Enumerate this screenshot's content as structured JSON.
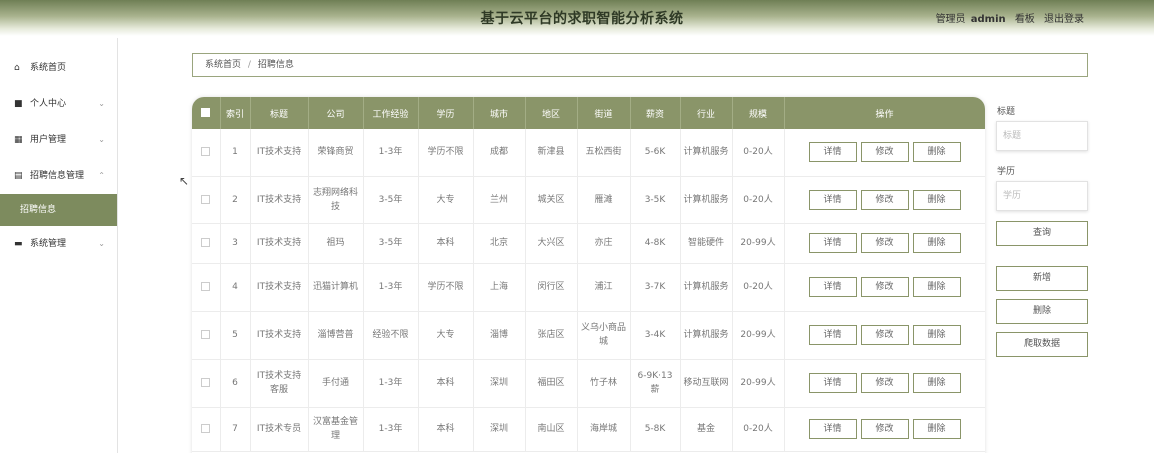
{
  "header": {
    "title": "基于云平台的求职智能分析系统",
    "user_role": "管理员",
    "user_name": "admin",
    "front_link": "看板",
    "logout": "退出登录"
  },
  "sidebar": {
    "items": [
      {
        "label": "系统首页",
        "icon": "home-icon",
        "glyph": "⌂"
      },
      {
        "label": "个人中心",
        "icon": "person-icon",
        "glyph": "👤",
        "arrow": "⌄"
      },
      {
        "label": "用户管理",
        "icon": "grid-icon",
        "glyph": "▦",
        "arrow": "⌄"
      },
      {
        "label": "招聘信息管理",
        "icon": "clipboard-icon",
        "glyph": "▤",
        "arrow": "⌃"
      },
      {
        "label": "系统管理",
        "icon": "briefcase-icon",
        "glyph": "▬",
        "arrow": "⌄"
      }
    ],
    "active_sub": "招聘信息"
  },
  "breadcrumb": {
    "home": "系统首页",
    "separator": "/",
    "current": "招聘信息"
  },
  "table": {
    "columns": [
      "索引",
      "标题",
      "公司",
      "工作经验",
      "学历",
      "城市",
      "地区",
      "街道",
      "薪资",
      "行业",
      "规模",
      "操作"
    ],
    "rows": [
      [
        "1",
        "IT技术支持",
        "荣锋商贸",
        "1-3年",
        "学历不限",
        "成都",
        "新津县",
        "五松西街",
        "5-6K",
        "计算机服务",
        "0-20人"
      ],
      [
        "2",
        "IT技术支持",
        "志翔网络科技",
        "3-5年",
        "大专",
        "兰州",
        "城关区",
        "雁滩",
        "3-5K",
        "计算机服务",
        "0-20人"
      ],
      [
        "3",
        "IT技术支持",
        "祖玛",
        "3-5年",
        "本科",
        "北京",
        "大兴区",
        "亦庄",
        "4-8K",
        "智能硬件",
        "20-99人"
      ],
      [
        "4",
        "IT技术支持",
        "迅猫计算机",
        "1-3年",
        "学历不限",
        "上海",
        "闵行区",
        "浦江",
        "3-7K",
        "计算机服务",
        "0-20人"
      ],
      [
        "5",
        "IT技术支持",
        "淄博营普",
        "经验不限",
        "大专",
        "淄博",
        "张店区",
        "义乌小商品城",
        "3-4K",
        "计算机服务",
        "20-99人"
      ],
      [
        "6",
        "IT技术支持客服",
        "手付通",
        "1-3年",
        "本科",
        "深圳",
        "福田区",
        "竹子林",
        "6-9K·13薪",
        "移动互联网",
        "20-99人"
      ],
      [
        "7",
        "IT技术专员",
        "汉富基金管理",
        "1-3年",
        "本科",
        "深圳",
        "南山区",
        "海岸城",
        "5-8K",
        "基金",
        "0-20人"
      ]
    ],
    "actions": {
      "detail": "详情",
      "edit": "修改",
      "delete": "删除"
    }
  },
  "search": {
    "title_label": "标题",
    "title_placeholder": "标题",
    "edu_label": "学历",
    "edu_placeholder": "学历",
    "query_button": "查询",
    "add_button": "新增",
    "delete_button": "删除",
    "crawl_button": "爬取数据"
  },
  "colors": {
    "accent": "#8a9569",
    "sidebar_active": "#7d8b5e"
  }
}
